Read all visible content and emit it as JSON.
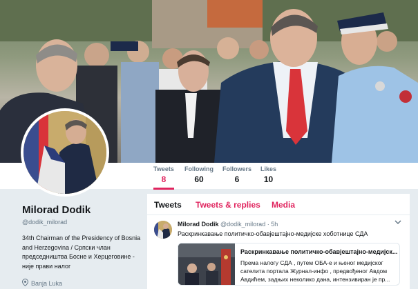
{
  "nav": {
    "stats": [
      {
        "label": "Tweets",
        "value": "8"
      },
      {
        "label": "Following",
        "value": "60"
      },
      {
        "label": "Followers",
        "value": "6"
      },
      {
        "label": "Likes",
        "value": "10"
      }
    ]
  },
  "profile": {
    "name": "Milorad Dodik",
    "handle": "@dodik_milorad",
    "bio": "34th Chairman of the Presidency of Bosnia and Herzegovina / Српски члан председништва Босне и Херцеговине - није прави налог",
    "location": "Banja Luka"
  },
  "timeline": {
    "tabs": [
      "Tweets",
      "Tweets & replies",
      "Media"
    ],
    "tweet": {
      "name": "Milorad Dodik",
      "handle": "@dodik_milorad",
      "time": "· 5h",
      "text": "Раскринкавање политичко-обавјештајно-медијске хоботнице СДА",
      "card": {
        "title": "Раскринкавање политичко-обавјештајно-медијск...",
        "body": "Према налогу СДА , путем ОБА-е и њеног медијског сателита портала Журнал-инфо , предвођеног Авдом Авдићем, задњих неколико дана, интензивиран је пр..."
      }
    }
  },
  "colors": {
    "accent": "#e0245e",
    "background": "#e6ecf0",
    "muted_text": "#657786"
  },
  "icons": {
    "location": "map-pin-icon",
    "tweet_menu": "chevron-down-icon"
  }
}
